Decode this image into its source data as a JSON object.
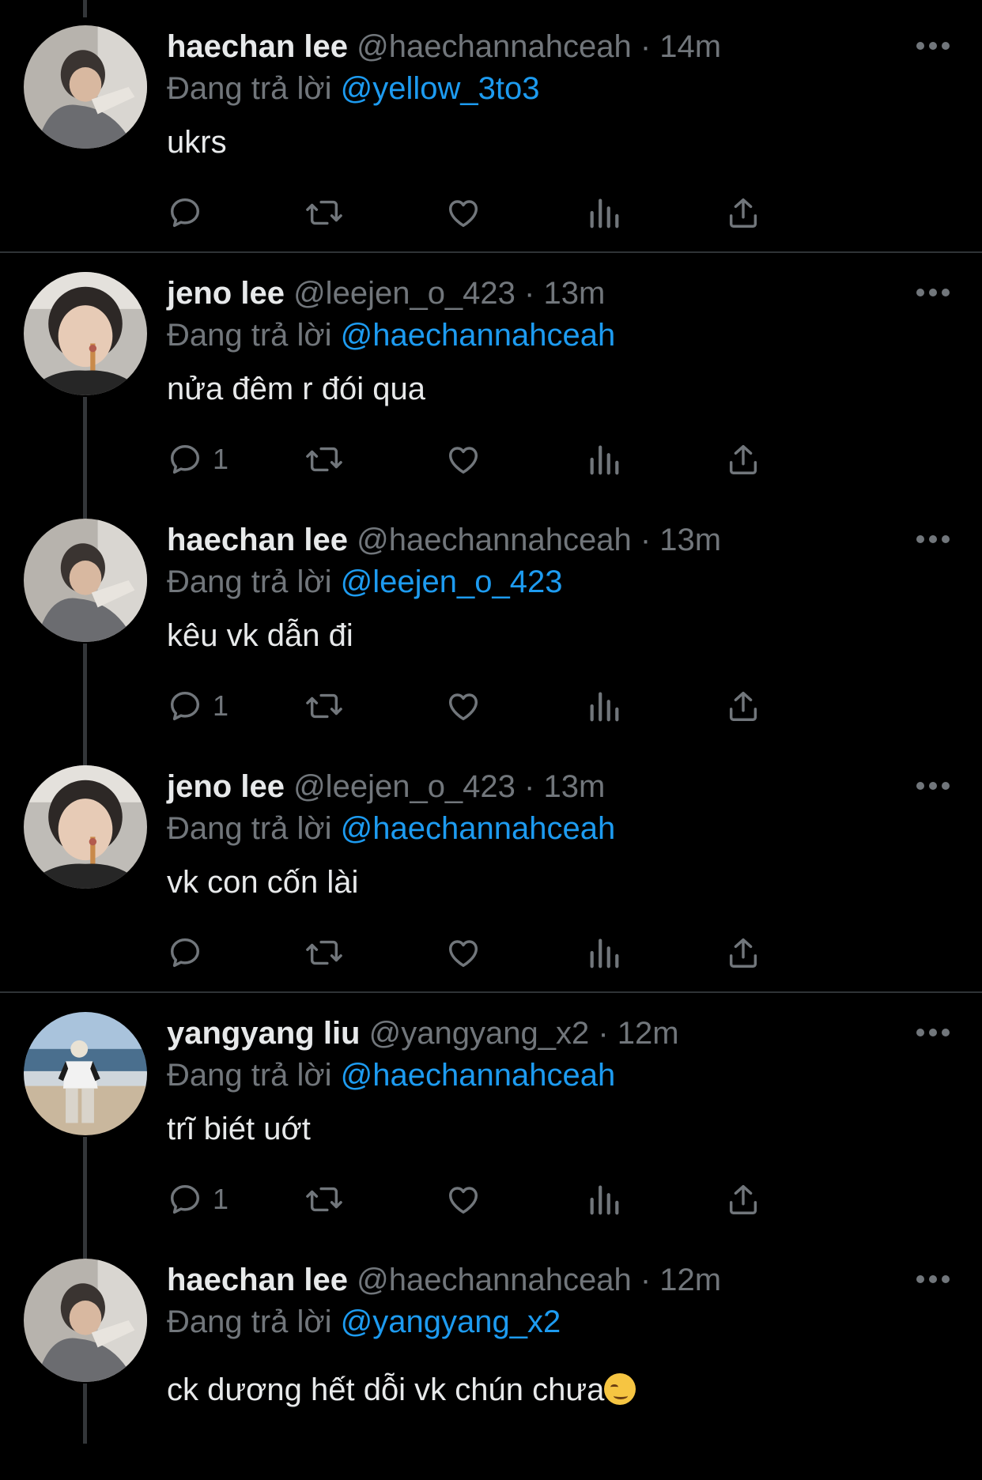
{
  "reply_prefix": "Đang trả lời",
  "colors": {
    "background": "#000000",
    "accent": "#1d9bf0",
    "secondary_text": "#71767b",
    "primary_text": "#e7e9ea"
  },
  "tweets": [
    {
      "name": "haechan lee",
      "handle": "@haechannahceah",
      "dot": "·",
      "time": "14m",
      "reply_to": "@yellow_3to3",
      "text": "ukrs",
      "reply_count": "",
      "avatar": "haechan-avatar"
    },
    {
      "name": "jeno lee",
      "handle": "@leejen_o_423",
      "dot": "·",
      "time": "13m",
      "reply_to": "@haechannahceah",
      "text": "nửa đêm r đói qua",
      "reply_count": "1",
      "avatar": "jeno-avatar"
    },
    {
      "name": "haechan lee",
      "handle": "@haechannahceah",
      "dot": "·",
      "time": "13m",
      "reply_to": "@leejen_o_423",
      "text": "kêu vk dẫn đi",
      "reply_count": "1",
      "avatar": "haechan-avatar"
    },
    {
      "name": "jeno lee",
      "handle": "@leejen_o_423",
      "dot": "·",
      "time": "13m",
      "reply_to": "@haechannahceah",
      "text": "vk con cốn lài",
      "reply_count": "",
      "avatar": "jeno-avatar"
    },
    {
      "name": "yangyang liu",
      "handle": "@yangyang_x2",
      "dot": "·",
      "time": "12m",
      "reply_to": "@haechannahceah",
      "text": "trĩ biét uớt",
      "reply_count": "1",
      "avatar": "yangyang-avatar"
    },
    {
      "name": "haechan lee",
      "handle": "@haechannahceah",
      "dot": "·",
      "time": "12m",
      "reply_to": "@yangyang_x2",
      "text": "ck dương hết dỗi vk chún chưa",
      "reply_count": "",
      "avatar": "haechan-avatar",
      "trailing_emoji": "smirking-face-emoji"
    }
  ],
  "icons": [
    "reply-icon",
    "retweet-icon",
    "like-icon",
    "views-icon",
    "share-icon",
    "more-icon"
  ]
}
